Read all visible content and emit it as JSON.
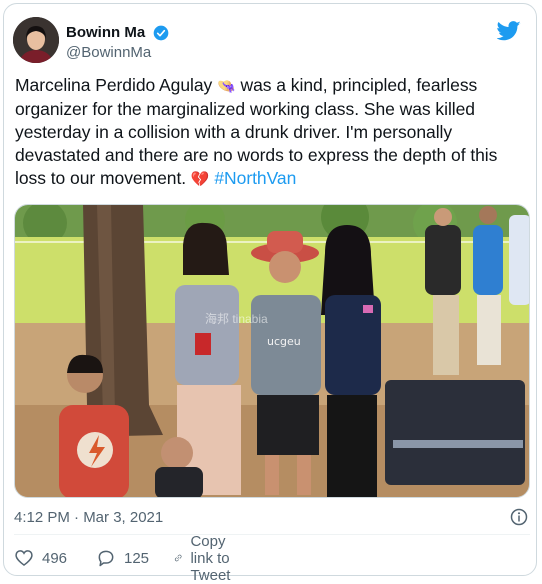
{
  "author": {
    "display_name": "Bowinn Ma",
    "handle": "@BowinnMa"
  },
  "tweet": {
    "text_before_emoji": "Marcelina Perdido Agulay ",
    "emoji_1": "👒",
    "text_after_emoji": " was a kind, principled, fearless organizer for the marginalized working class. She was killed yesterday in a collision with a drunk driver. I'm personally devastated and there are no words to express the depth of this loss to our movement. ",
    "emoji_2": "💔",
    "hashtag": "#NorthVan"
  },
  "photo": {
    "shirt_text": "ucgeu",
    "watermark": "海邦 tinabia"
  },
  "meta": {
    "timestamp": "4:12 PM · Mar 3, 2021"
  },
  "actions": {
    "like_count": "496",
    "reply_count": "125",
    "copy_label": "Copy link to Tweet"
  },
  "colors": {
    "accent": "#1d9bf0",
    "secondary_text": "#536471",
    "border": "#cfd9de"
  },
  "icons": [
    "verified-badge-icon",
    "twitter-bird-icon",
    "info-icon",
    "heart-icon",
    "reply-icon",
    "link-icon"
  ]
}
